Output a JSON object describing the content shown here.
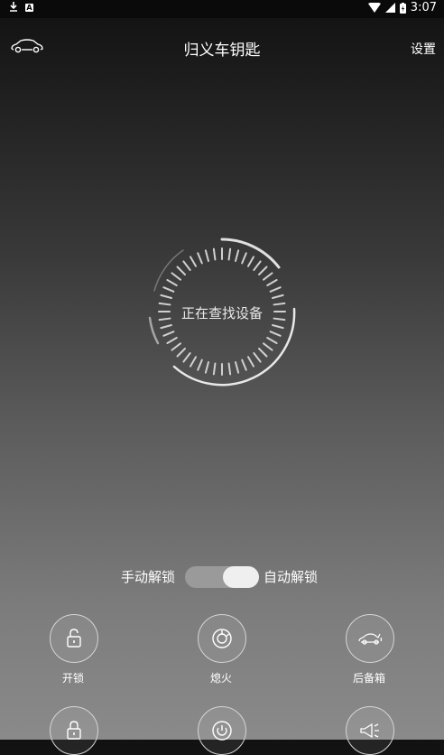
{
  "status_bar": {
    "time": "3:07"
  },
  "header": {
    "title": "归义车钥匙",
    "settings_label": "设置"
  },
  "scanner": {
    "text": "正在查找设备"
  },
  "unlock_mode": {
    "manual_label": "手动解锁",
    "auto_label": "自动解锁",
    "selected": "自动解锁"
  },
  "actions": [
    {
      "label": "开锁",
      "icon": "unlock-icon"
    },
    {
      "label": "熄火",
      "icon": "engine-off-icon"
    },
    {
      "label": "后备箱",
      "icon": "trunk-icon"
    },
    {
      "label": "",
      "icon": "lock-icon"
    },
    {
      "label": "",
      "icon": "power-icon"
    },
    {
      "label": "",
      "icon": "horn-icon"
    }
  ]
}
